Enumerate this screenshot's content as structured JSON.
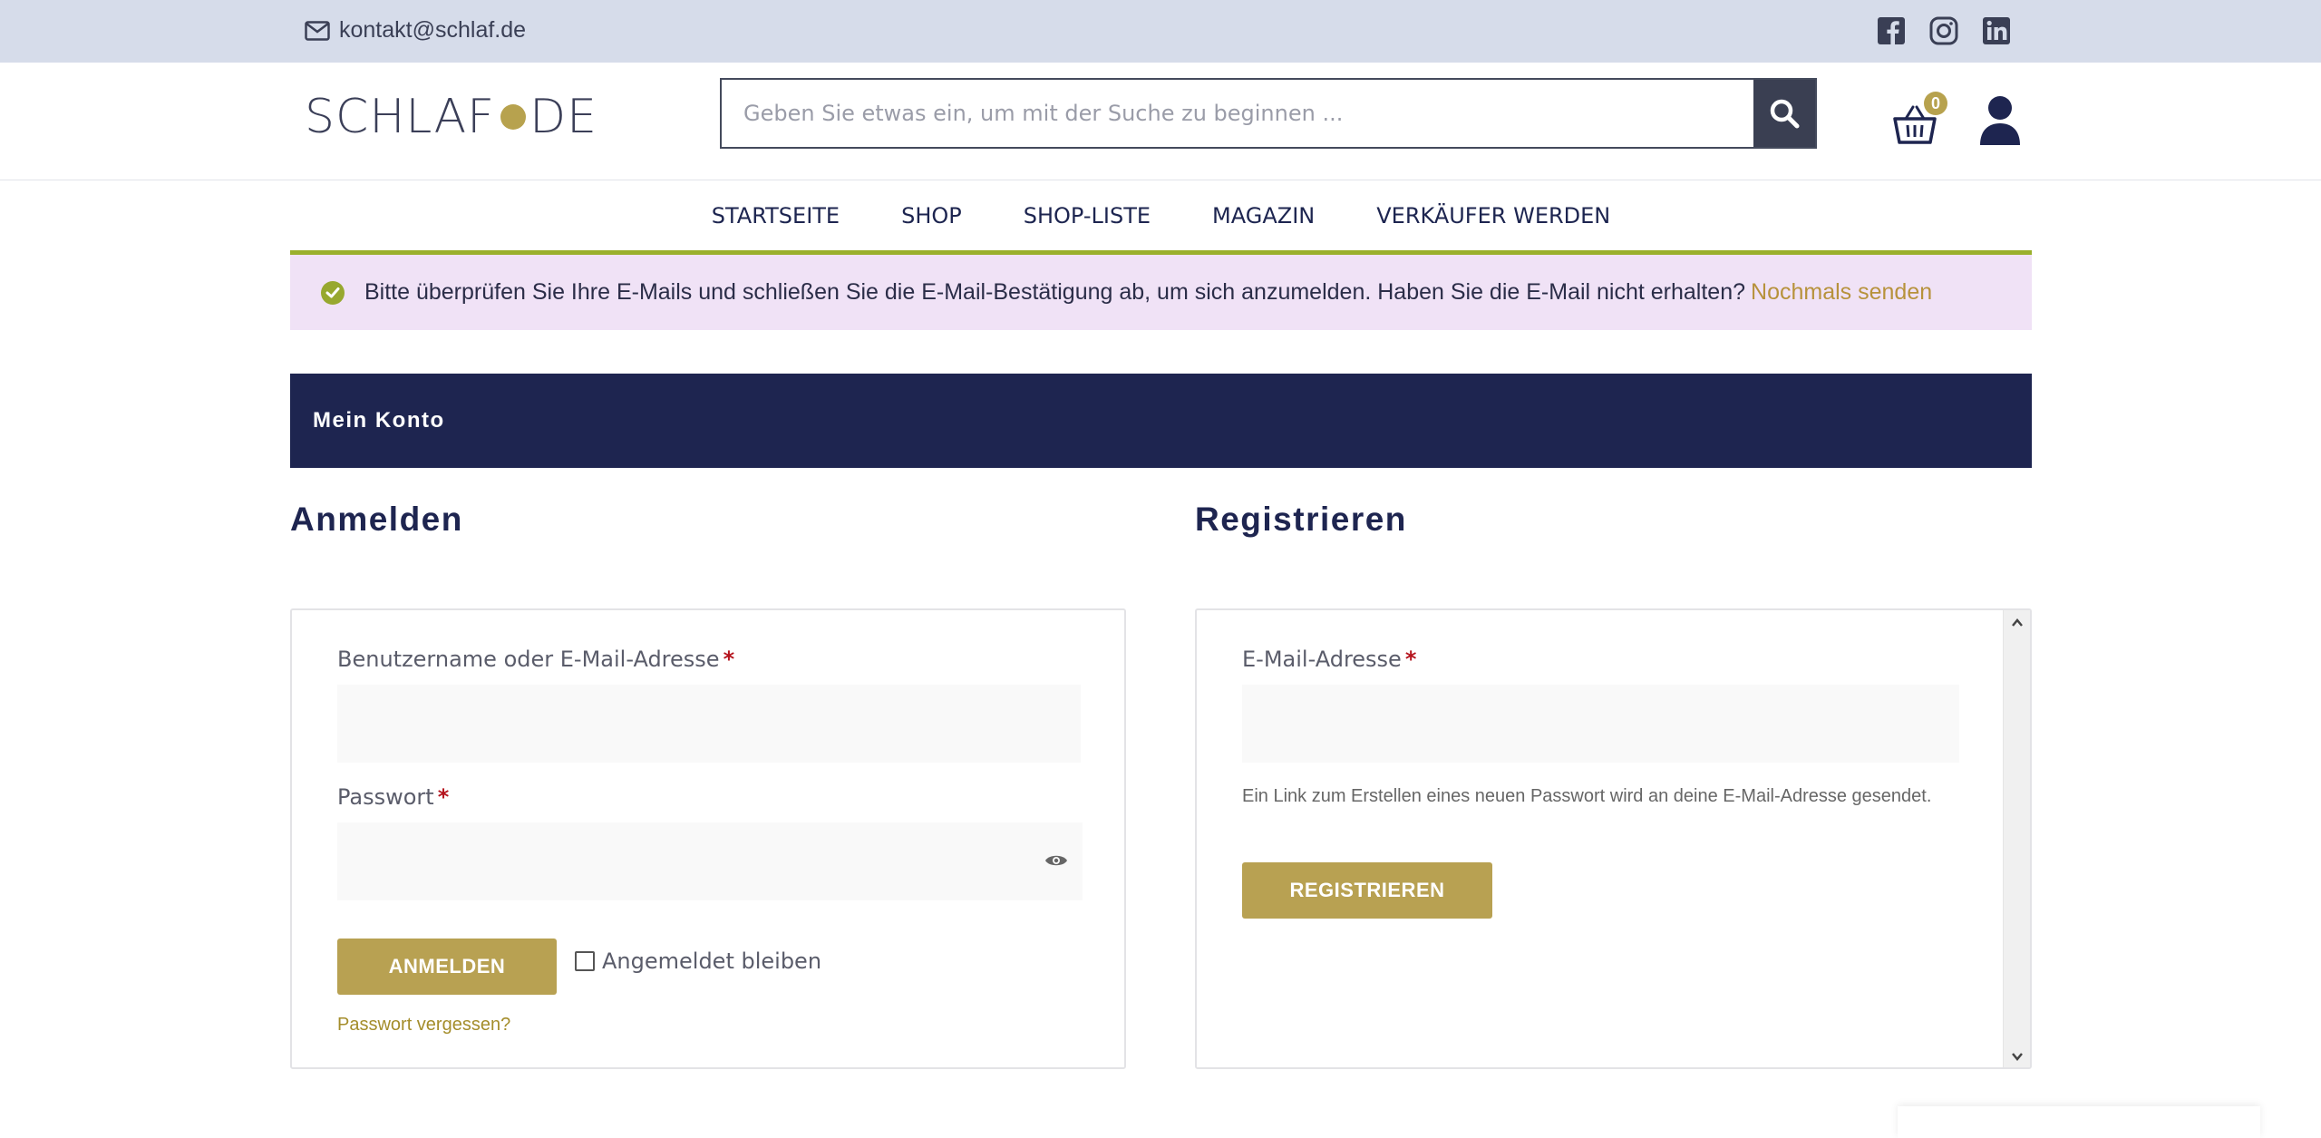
{
  "topbar": {
    "email": "kontakt@schlaf.de",
    "socials": [
      "facebook-icon",
      "instagram-icon",
      "linkedin-icon"
    ]
  },
  "header": {
    "logo_left": "SCHLAF",
    "logo_right": "DE",
    "search_placeholder": "Geben Sie etwas ein, um mit der Suche zu beginnen ...",
    "cart_count": "0"
  },
  "nav": {
    "items": [
      "STARTSEITE",
      "SHOP",
      "SHOP-LISTE",
      "MAGAZIN",
      "VERKÄUFER WERDEN"
    ]
  },
  "notice": {
    "text": "Bitte überprüfen Sie Ihre E-Mails und schließen Sie die E-Mail-Bestätigung ab, um sich anzumelden. Haben Sie die E-Mail nicht erhalten?",
    "link": "Nochmals senden"
  },
  "banner": {
    "title": "Mein Konto"
  },
  "login": {
    "heading": "Anmelden",
    "username_label": "Benutzername oder E-Mail-Adresse",
    "password_label": "Passwort",
    "required_mark": "*",
    "submit": "ANMELDEN",
    "remember": "Angemeldet bleiben",
    "forgot": "Passwort vergessen?"
  },
  "register": {
    "heading": "Registrieren",
    "email_label": "E-Mail-Adresse",
    "required_mark": "*",
    "hint": "Ein Link zum Erstellen eines neuen Passwort wird an deine E-Mail-Adresse gesendet.",
    "submit": "REGISTRIEREN"
  },
  "colors": {
    "navy": "#1e2550",
    "gold": "#b8a152",
    "green": "#9ab02c",
    "notice_bg": "#f0e2f6",
    "topbar_bg": "#d6dcea"
  }
}
